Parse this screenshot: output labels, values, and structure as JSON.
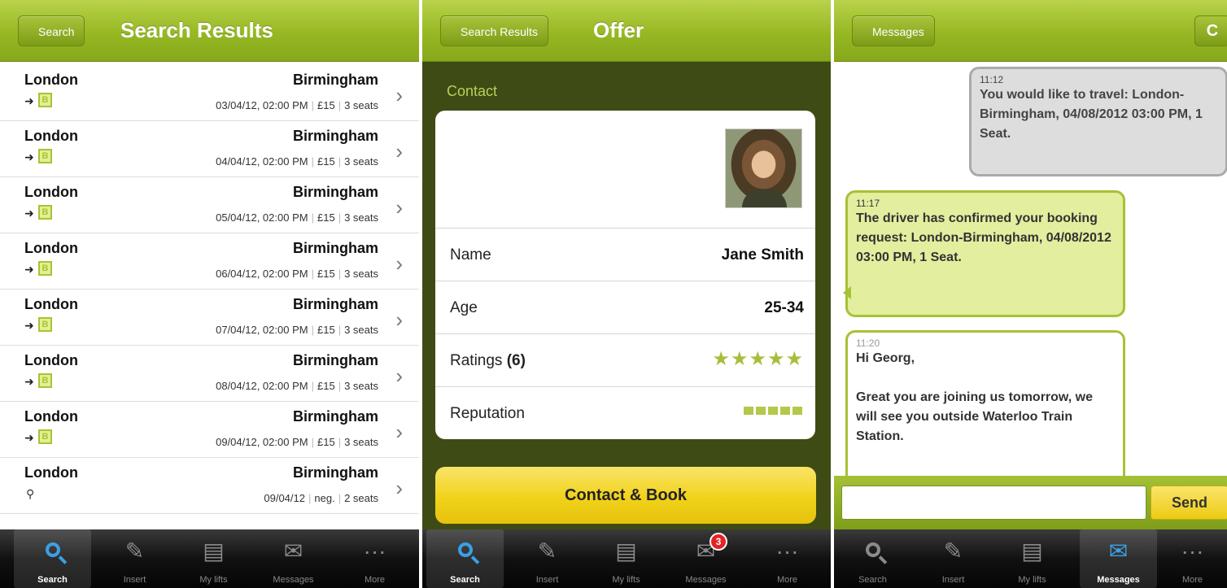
{
  "screen1": {
    "back_label": "Search",
    "title": "Search Results",
    "rows": [
      {
        "from": "London",
        "to": "Birmingham",
        "date": "03/04/12, 02:00 PM",
        "price": "£15",
        "seats": "3 seats",
        "kind": "B"
      },
      {
        "from": "London",
        "to": "Birmingham",
        "date": "04/04/12, 02:00 PM",
        "price": "£15",
        "seats": "3 seats",
        "kind": "B"
      },
      {
        "from": "London",
        "to": "Birmingham",
        "date": "05/04/12, 02:00 PM",
        "price": "£15",
        "seats": "3 seats",
        "kind": "B"
      },
      {
        "from": "London",
        "to": "Birmingham",
        "date": "06/04/12, 02:00 PM",
        "price": "£15",
        "seats": "3 seats",
        "kind": "B"
      },
      {
        "from": "London",
        "to": "Birmingham",
        "date": "07/04/12, 02:00 PM",
        "price": "£15",
        "seats": "3 seats",
        "kind": "B"
      },
      {
        "from": "London",
        "to": "Birmingham",
        "date": "08/04/12, 02:00 PM",
        "price": "£15",
        "seats": "3 seats",
        "kind": "B"
      },
      {
        "from": "London",
        "to": "Birmingham",
        "date": "09/04/12, 02:00 PM",
        "price": "£15",
        "seats": "3 seats",
        "kind": "B"
      },
      {
        "from": "London",
        "to": "Birmingham",
        "date": "09/04/12",
        "price": "neg.",
        "seats": "2 seats",
        "kind": "pin"
      }
    ]
  },
  "screen2": {
    "back_label": "Search Results",
    "title": "Offer",
    "section_header": "Contact",
    "name_label": "Name",
    "name_value": "Jane Smith",
    "age_label": "Age",
    "age_value": "25-34",
    "ratings_label": "Ratings",
    "ratings_count": "(6)",
    "ratings_stars": "★★★★★",
    "reputation_label": "Reputation",
    "book_label": "Contact & Book",
    "badge_count": "3"
  },
  "screen3": {
    "back_label": "Messages",
    "refresh_icon": "C",
    "messages": [
      {
        "time": "11:12",
        "text": "You would like to travel: London-Birmingham, 04/08/2012 03:00 PM, 1 Seat."
      },
      {
        "time": "11:17",
        "text": "The driver has confirmed your booking request: London-Birmingham, 04/08/2012 03:00 PM, 1 Seat."
      },
      {
        "time": "11:20",
        "line1": "Hi Georg,",
        "line2": "Great you are joining us tomorrow, we will see you outside Waterloo Train Station."
      }
    ],
    "input_value": "",
    "send_label": "Send"
  },
  "tabbar": {
    "tabs": [
      "Search",
      "Insert",
      "My lifts",
      "Messages",
      "More"
    ]
  },
  "colors": {
    "brand_green": "#96b823",
    "accent_yellow": "#f1d21a",
    "active_tab_blue": "#3ba0e6"
  }
}
